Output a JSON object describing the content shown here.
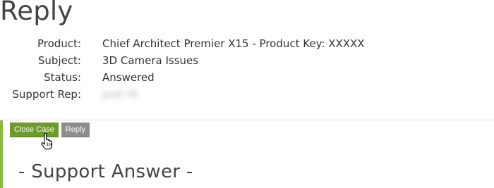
{
  "page": {
    "title": "Reply"
  },
  "details": [
    {
      "label": "Product:",
      "value": "Chief Architect Premier X15 - Product Key: XXXXX"
    },
    {
      "label": "Subject:",
      "value": "3D Camera Issues"
    },
    {
      "label": "Status:",
      "value": "Answered"
    },
    {
      "label": "Support Rep:",
      "value": "Josh W."
    }
  ],
  "actions": {
    "close_case_label": "Close Case",
    "reply_label": "Reply"
  },
  "answer": {
    "heading": "- Support Answer -"
  },
  "colors": {
    "accent": "#8ab83d",
    "close_case_button": "#6f9a2e",
    "reply_button": "#8d8d8d"
  },
  "icons": {
    "cursor": "hand-pointer-icon"
  }
}
